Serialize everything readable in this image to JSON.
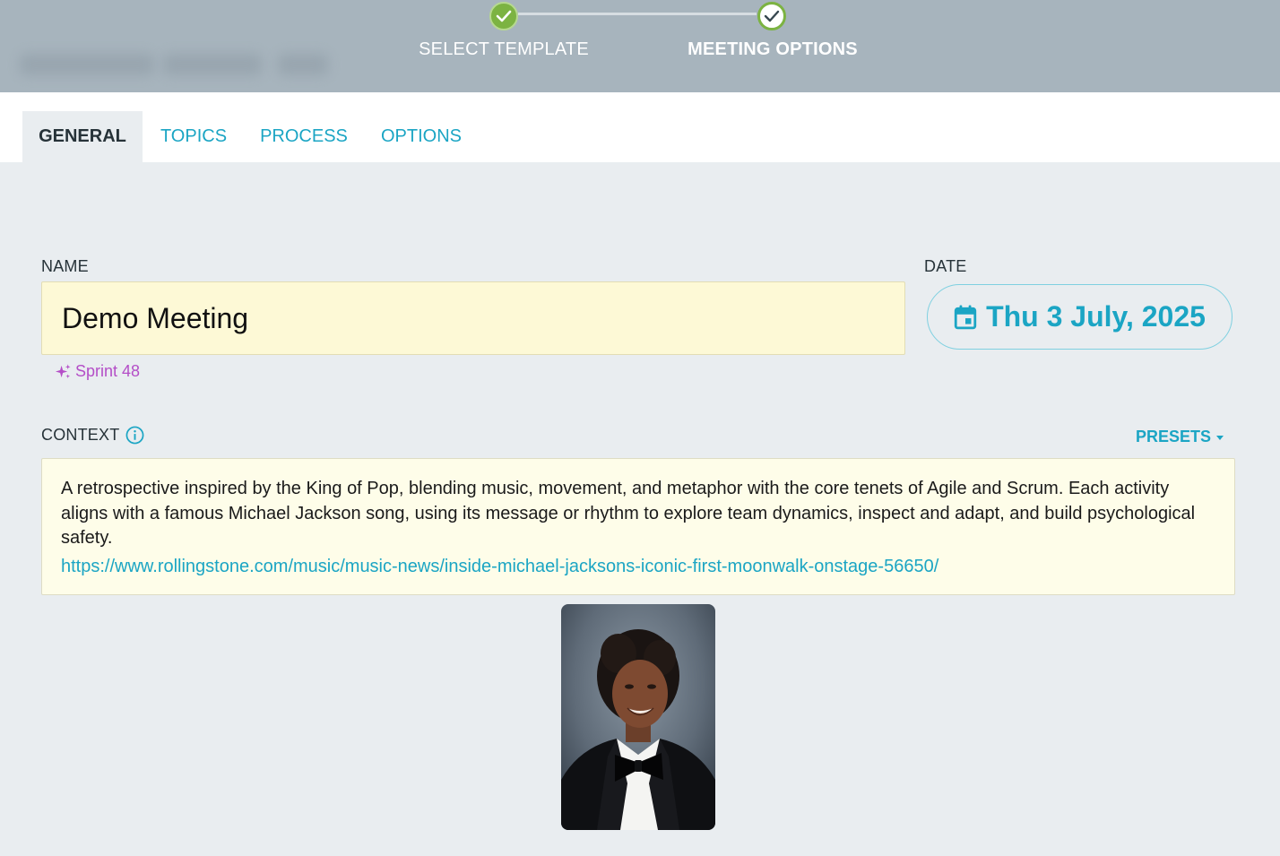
{
  "stepper": {
    "steps": [
      {
        "label": "SELECT TEMPLATE",
        "state": "done"
      },
      {
        "label": "MEETING OPTIONS",
        "state": "current"
      }
    ]
  },
  "tabs": [
    {
      "label": "GENERAL",
      "active": true
    },
    {
      "label": "TOPICS",
      "active": false
    },
    {
      "label": "PROCESS",
      "active": false
    },
    {
      "label": "OPTIONS",
      "active": false
    }
  ],
  "form": {
    "name_label": "NAME",
    "name_value": "Demo Meeting",
    "name_suggestion": "Sprint 48",
    "date_label": "DATE",
    "date_value": "Thu 3 July, 2025",
    "context_label": "CONTEXT",
    "presets_label": "PRESETS",
    "context_text": "A retrospective inspired by the King of Pop, blending music, movement, and metaphor with the core tenets of Agile and Scrum. Each activity aligns with a famous Michael Jackson song, using its message or rhythm to explore team dynamics, inspect and adapt, and build psychological safety.",
    "context_link": "https://www.rollingstone.com/music/music-news/inside-michael-jacksons-iconic-first-moonwalk-onstage-56650/"
  },
  "colors": {
    "accent": "#1ba5c4",
    "step_done": "#7cb342",
    "suggestion": "#b44ec7",
    "topbar": "#a7b4bd",
    "input_bg": "#fdf9d6"
  },
  "icons": [
    "check-icon",
    "calendar-icon",
    "sparkle-icon",
    "info-icon",
    "caret-down-icon"
  ]
}
